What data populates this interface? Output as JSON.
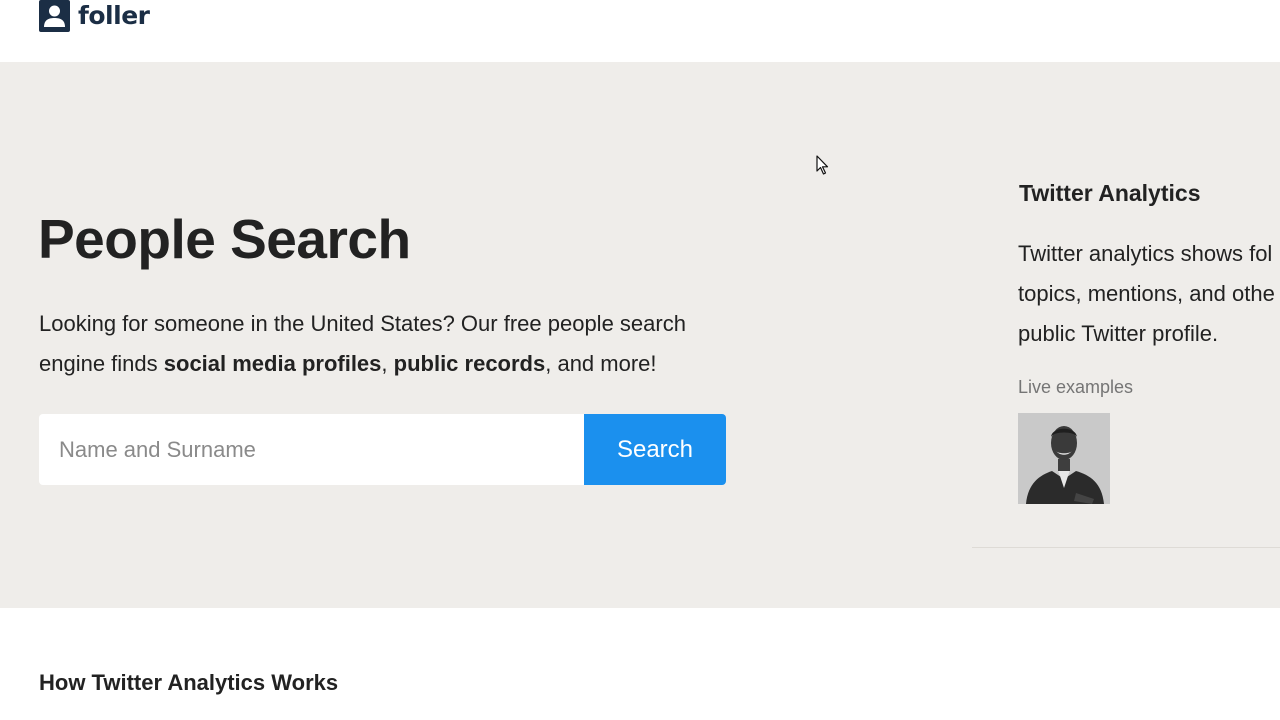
{
  "header": {
    "logo_text": "foller",
    "logo_icon": "user-badge-icon",
    "brand_color": "#1b2e45"
  },
  "hero": {
    "background": "#efedea",
    "title": "People Search",
    "description": {
      "part1": "Looking for someone in the United States? Our free people search engine finds ",
      "bold1": "social media profiles",
      "part2": ", ",
      "bold2": "public records",
      "part3": ", and more!"
    },
    "search": {
      "placeholder": "Name and Surname",
      "value": "",
      "button_label": "Search",
      "button_color": "#1b90ee"
    }
  },
  "sidebar": {
    "title": "Twitter Analytics",
    "text_lines": [
      "Twitter analytics shows fol",
      "topics, mentions, and othe",
      "public Twitter profile."
    ],
    "live_label": "Live examples",
    "live_example_icon": "profile-photo-thumbnail"
  },
  "section": {
    "title": "How Twitter Analytics Works"
  }
}
